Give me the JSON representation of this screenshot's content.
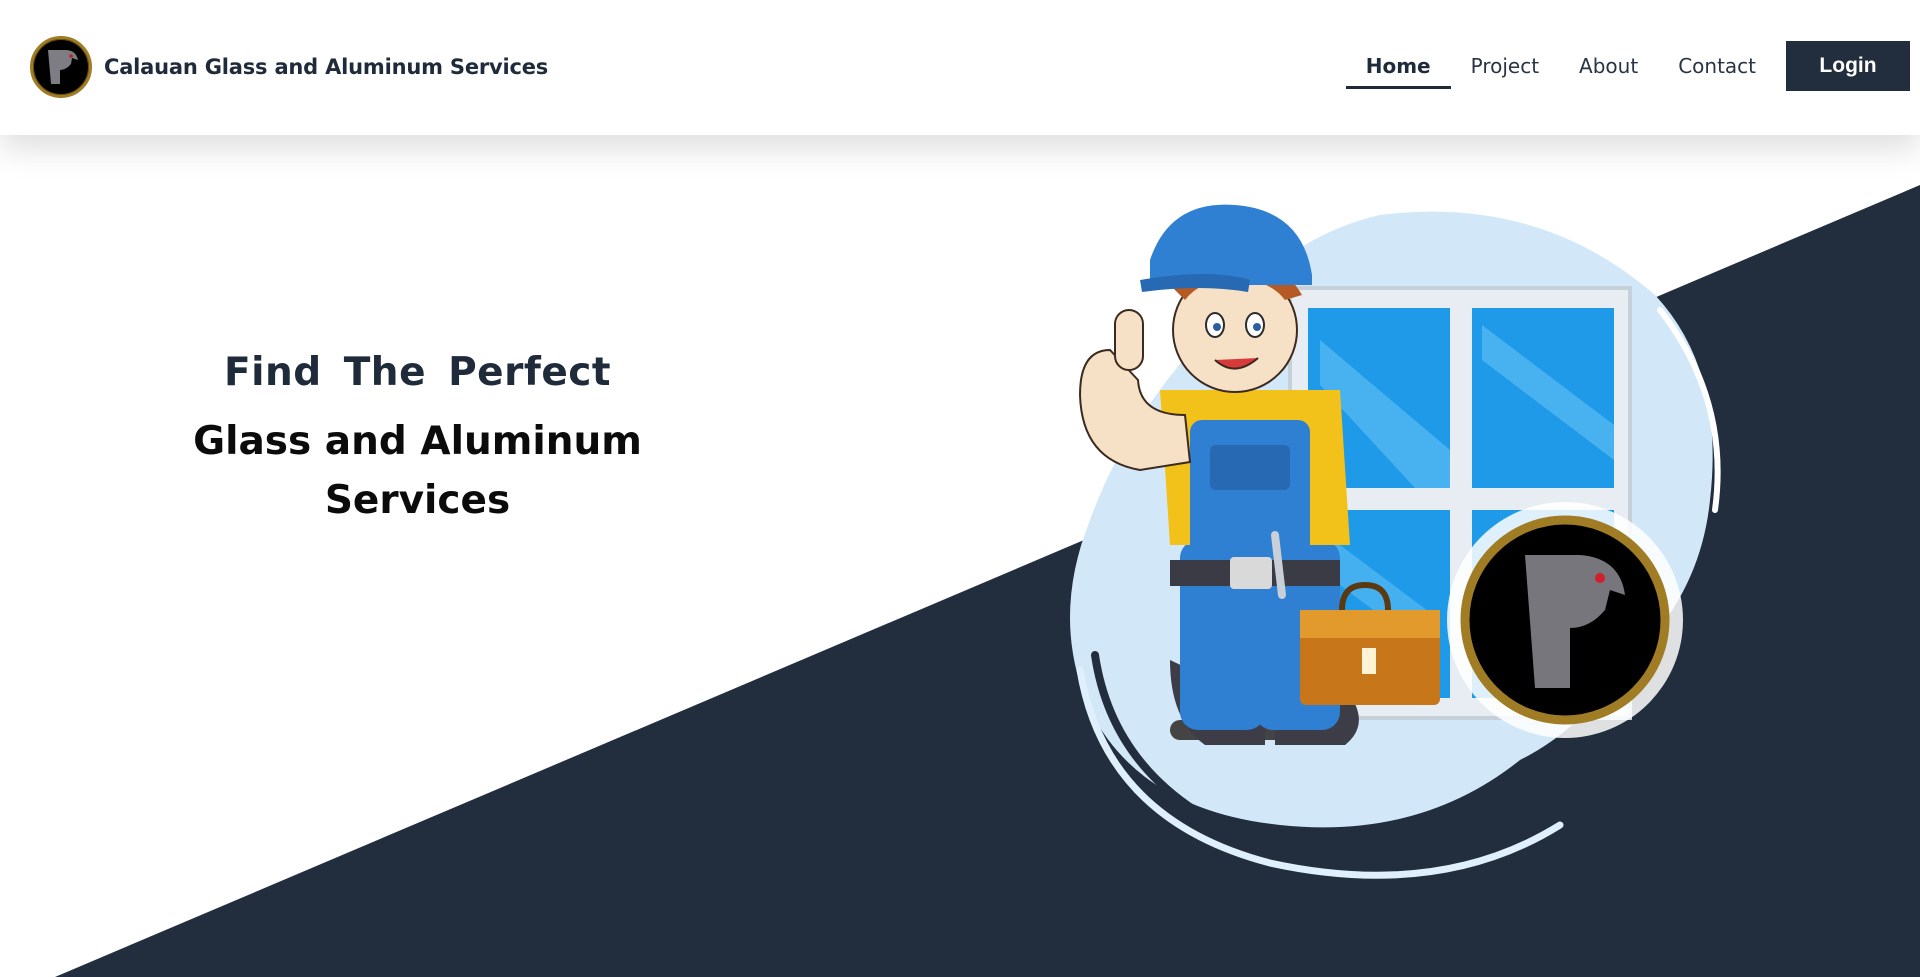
{
  "header": {
    "brand_name": "Calauan Glass and Aluminum Services",
    "logo_icon": "eagle-logo-icon"
  },
  "nav": {
    "items": [
      {
        "label": "Home",
        "active": true
      },
      {
        "label": "Project",
        "active": false
      },
      {
        "label": "About",
        "active": false
      },
      {
        "label": "Contact",
        "active": false
      }
    ],
    "login_label": "Login"
  },
  "hero": {
    "line1": "Find The Perfect",
    "line2": "Glass and Aluminum Services"
  },
  "illustration": {
    "icon": "worker-with-window-illustration",
    "badge_icon": "eagle-logo-icon"
  },
  "colors": {
    "dark_navy": "#222e3e",
    "light_blue_blob": "#cfe6f8",
    "gold_ring": "#a07d25"
  }
}
